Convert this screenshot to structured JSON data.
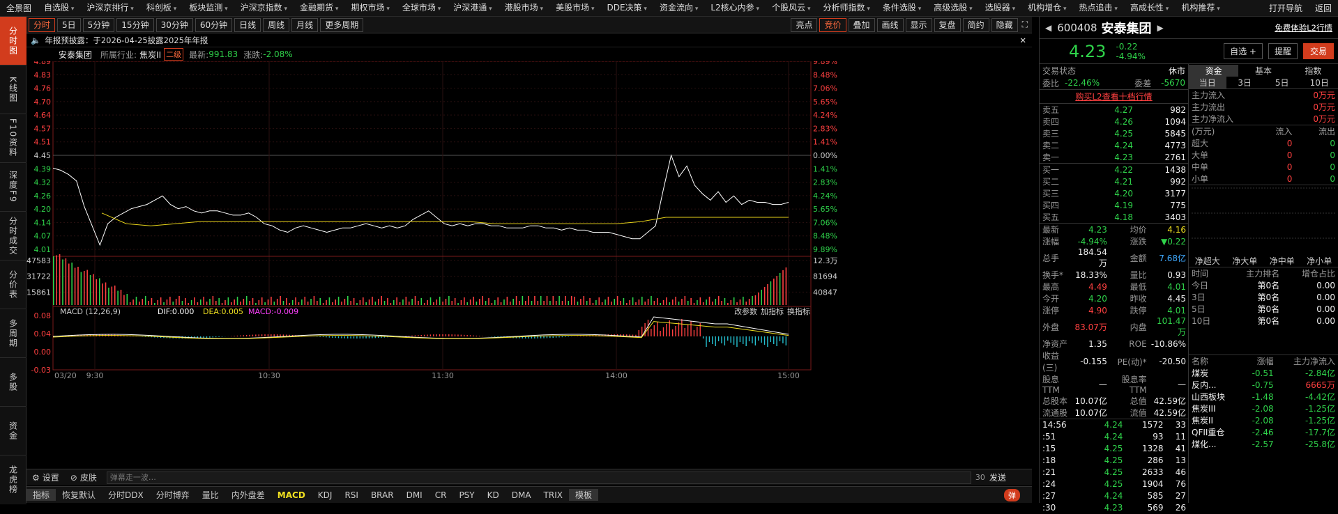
{
  "menu": [
    "全景图",
    "自选股",
    "沪深京排行",
    "科创板",
    "板块监测",
    "沪深京指数",
    "金融期货",
    "期权市场",
    "全球市场",
    "沪深港通",
    "港股市场",
    "美股市场",
    "DDE决策",
    "资金流向",
    "L2核心内参",
    "个股风云",
    "分析师指数",
    "条件选股",
    "高级选股",
    "选股器",
    "机构增仓",
    "热点追击",
    "高成长性",
    "机构推荐",
    "打开导航",
    "返回"
  ],
  "left_tabs": [
    "分时图",
    "K线图",
    "F10资料",
    "深度F9",
    "分时成交",
    "分价表",
    "多周期",
    "多股",
    "资金",
    "龙虎榜"
  ],
  "toolbar": {
    "periods": [
      "分时",
      "5日",
      "5分钟",
      "15分钟",
      "30分钟",
      "60分钟",
      "日线",
      "周线",
      "月线",
      "更多周期"
    ],
    "right": [
      "亮点",
      "竞价",
      "叠加",
      "画线",
      "显示",
      "复盘",
      "简约",
      "隐藏"
    ]
  },
  "notice": "年报预披露：于2026-04-25披露2025年年报",
  "info": {
    "name": "安泰集团",
    "industry_label": "所属行业:",
    "industry": "焦炭II",
    "level": "二级",
    "latest_label": "最新:",
    "latest": "991.83",
    "chg_label": "涨跌:",
    "chg": "-2.08%"
  },
  "chart_data": [
    {
      "type": "line",
      "title": "",
      "x": [
        "9:30",
        "10:30",
        "11:30",
        "14:00",
        "15:00"
      ],
      "y_ticks": [
        "4.89",
        "4.83",
        "4.76",
        "4.70",
        "4.64",
        "4.57",
        "4.51",
        "4.45",
        "4.39",
        "4.32",
        "4.26",
        "4.20",
        "4.14",
        "4.07",
        "4.01"
      ],
      "pct_ticks": [
        "9.89%",
        "8.48%",
        "7.06%",
        "5.65%",
        "4.24%",
        "2.83%",
        "1.41%",
        "0.00%",
        "1.41%",
        "2.83%",
        "4.24%",
        "5.65%",
        "7.06%",
        "8.48%",
        "9.89%"
      ],
      "ylim": [
        4.01,
        4.89
      ],
      "prev_close": 4.45,
      "series": [
        {
          "kind": "price",
          "color": "#ffffff",
          "values": [
            4.39,
            4.38,
            4.36,
            4.33,
            4.21,
            4.12,
            4.03,
            4.13,
            4.16,
            4.18,
            4.2,
            4.21,
            4.22,
            4.24,
            4.26,
            4.22,
            4.2,
            4.21,
            4.19,
            4.18,
            4.19,
            4.19,
            4.18,
            4.17,
            4.17,
            4.18,
            4.16,
            4.13,
            4.12,
            4.1,
            4.09,
            4.11,
            4.12,
            4.11,
            4.1,
            4.09,
            4.1,
            4.11,
            4.11,
            4.12,
            4.13,
            4.12,
            4.11,
            4.12,
            4.11,
            4.12,
            4.15,
            4.17,
            4.19,
            4.16,
            4.13,
            4.12,
            4.13,
            4.12,
            4.13,
            4.13,
            4.12,
            4.12,
            4.11,
            4.11,
            4.11,
            4.12,
            4.12,
            4.11,
            4.11,
            4.1,
            4.11,
            4.1,
            4.1,
            4.09,
            4.09,
            4.09,
            4.08,
            4.07,
            4.06,
            4.06,
            4.09,
            4.12,
            4.29,
            4.45,
            4.35,
            4.4,
            4.31,
            4.27,
            4.24,
            4.28,
            4.23,
            4.26,
            4.22,
            4.24,
            4.23,
            4.23,
            4.22,
            4.22,
            4.23
          ]
        },
        {
          "kind": "avg",
          "color": "#e6d21a",
          "values": [
            4.18,
            4.13,
            4.12,
            4.13,
            4.14,
            4.14,
            4.14,
            4.14,
            4.14,
            4.14,
            4.14,
            4.14,
            4.14,
            4.14,
            4.14,
            4.14,
            4.13,
            4.13,
            4.13,
            4.13,
            4.13,
            4.13,
            4.14,
            4.16,
            4.16,
            4.16,
            4.16,
            4.16,
            4.16
          ]
        }
      ]
    },
    {
      "type": "bar",
      "title": "",
      "y_ticks": [
        "47583",
        "31722",
        "15861"
      ],
      "right_ticks": [
        "12.3万",
        "81694",
        "40847"
      ],
      "note": "volume"
    },
    {
      "type": "bar",
      "title": "MACD (12,26,9)",
      "y_ticks": [
        "0.08",
        "0.04",
        "0.00",
        "-0.03"
      ],
      "dif": "0.000",
      "dea": "0.005",
      "macd": "-0.009"
    }
  ],
  "x_label_start": "03/20",
  "macd_buttons": [
    "改参数",
    "加指标",
    "换指标"
  ],
  "bottom_tabs": [
    "指标",
    "恢复默认",
    "分时DDX",
    "分时博弈",
    "量比",
    "内外盘差",
    "MACD",
    "KDJ",
    "RSI",
    "BRAR",
    "DMI",
    "CR",
    "PSY",
    "KD",
    "DMA",
    "TRIX",
    "模板"
  ],
  "setbar": {
    "settings": "设置",
    "skin": "皮肤",
    "danmu_placeholder": "弹幕走一波…",
    "count": "30",
    "send": "发送",
    "toggle": "弹"
  },
  "stock": {
    "code": "600408",
    "name": "安泰集团",
    "price": "4.23",
    "change": "-0.22",
    "pct": "-4.94%",
    "free_trial": "免费体验L2行情",
    "add_fav": "自选 +",
    "remind": "提醒",
    "trade": "交易"
  },
  "trade_status": {
    "label": "交易状态",
    "value": "休市",
    "wb_label": "委比",
    "wb": "-22.46%",
    "wc_label": "委差",
    "wc": "-5670",
    "buy_l2": "购买L2查看十档行情"
  },
  "asks": [
    [
      "卖五",
      "4.27",
      "982"
    ],
    [
      "卖四",
      "4.26",
      "1094"
    ],
    [
      "卖三",
      "4.25",
      "5845"
    ],
    [
      "卖二",
      "4.24",
      "4773"
    ],
    [
      "卖一",
      "4.23",
      "2761"
    ]
  ],
  "bids": [
    [
      "买一",
      "4.22",
      "1438"
    ],
    [
      "买二",
      "4.21",
      "992"
    ],
    [
      "买三",
      "4.20",
      "3177"
    ],
    [
      "买四",
      "4.19",
      "775"
    ],
    [
      "买五",
      "4.18",
      "3403"
    ]
  ],
  "stats": [
    [
      "最新",
      "4.23",
      "均价",
      "4.16"
    ],
    [
      "涨幅",
      "-4.94%",
      "涨跌",
      "▼0.22"
    ],
    [
      "总手",
      "184.54万",
      "金额",
      "7.68亿"
    ],
    [
      "换手*",
      "18.33%",
      "量比",
      "0.93"
    ],
    [
      "最高",
      "4.49",
      "最低",
      "4.01"
    ],
    [
      "今开",
      "4.20",
      "昨收",
      "4.45"
    ],
    [
      "涨停",
      "4.90",
      "跌停",
      "4.01"
    ],
    [
      "外盘",
      "83.07万",
      "内盘",
      "101.47万"
    ],
    [
      "净资产",
      "1.35",
      "ROE",
      "-10.86%"
    ],
    [
      "收益(三)",
      "-0.155",
      "PE(动)*",
      "-20.50"
    ],
    [
      "股息TTM",
      "—",
      "股息率TTM",
      "—"
    ],
    [
      "总股本",
      "10.07亿",
      "总值",
      "42.59亿"
    ],
    [
      "流通股",
      "10.07亿",
      "流值",
      "42.59亿"
    ]
  ],
  "ticks": [
    [
      "14:56",
      "4.24",
      "1572",
      "33"
    ],
    [
      ":51",
      "4.24",
      "93",
      "11"
    ],
    [
      ":15",
      "4.25",
      "1328",
      "41"
    ],
    [
      ":18",
      "4.25",
      "286",
      "13"
    ],
    [
      ":21",
      "4.25",
      "2633",
      "46"
    ],
    [
      ":24",
      "4.25",
      "1904",
      "76"
    ],
    [
      ":27",
      "4.24",
      "585",
      "27"
    ],
    [
      ":30",
      "4.23",
      "569",
      "26"
    ]
  ],
  "funds": {
    "tabs": [
      "资金",
      "基本",
      "指数"
    ],
    "periods": [
      "当日",
      "3日",
      "5日",
      "10日"
    ],
    "rows": [
      [
        "主力流入",
        "0万元"
      ],
      [
        "主力流出",
        "0万元"
      ],
      [
        "主力净流入",
        "0万元"
      ]
    ],
    "unit": "(万元)",
    "flow_headers": [
      "流入",
      "流出"
    ],
    "flow_rows": [
      [
        "超大",
        "0",
        "0"
      ],
      [
        "大单",
        "0",
        "0"
      ],
      [
        "中单",
        "0",
        "0"
      ],
      [
        "小单",
        "0",
        "0"
      ]
    ],
    "legend": [
      "净超大",
      "净大单",
      "净中单",
      "净小单"
    ],
    "rank_headers": [
      "时间",
      "主力排名",
      "增仓占比"
    ],
    "rank_rows": [
      [
        "今日",
        "第0名",
        "0.00"
      ],
      [
        "3日",
        "第0名",
        "0.00"
      ],
      [
        "5日",
        "第0名",
        "0.00"
      ],
      [
        "10日",
        "第0名",
        "0.00"
      ]
    ]
  },
  "sectors": {
    "headers": [
      "名称",
      "涨幅",
      "主力净流入"
    ],
    "rows": [
      [
        "煤炭",
        "-0.51",
        "-2.84亿"
      ],
      [
        "反内...",
        "-0.75",
        "6665万"
      ],
      [
        "山西板块",
        "-1.48",
        "-4.42亿"
      ],
      [
        "焦炭III",
        "-2.08",
        "-1.25亿"
      ],
      [
        "焦炭II",
        "-2.08",
        "-1.25亿"
      ],
      [
        "QFII重仓",
        "-2.46",
        "-17.7亿"
      ],
      [
        "煤化...",
        "-2.57",
        "-25.8亿"
      ]
    ]
  }
}
